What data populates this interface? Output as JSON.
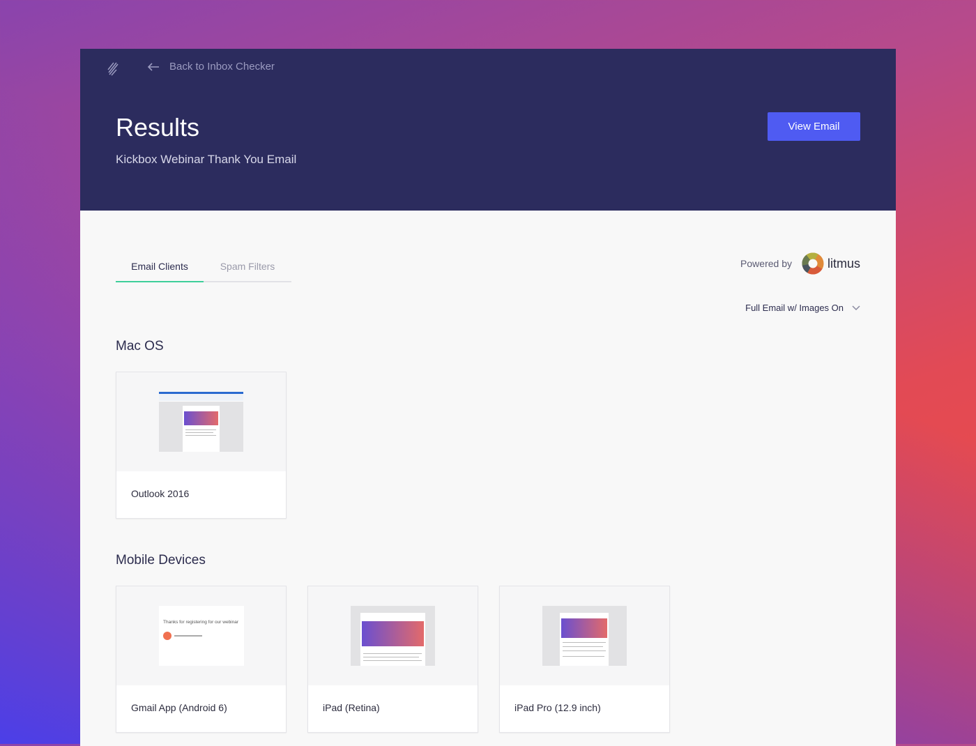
{
  "header": {
    "back_label": "Back to Inbox Checker",
    "title": "Results",
    "subtitle": "Kickbox Webinar Thank You Email",
    "view_email_label": "View Email"
  },
  "tabs": [
    {
      "label": "Email Clients",
      "active": true
    },
    {
      "label": "Spam Filters",
      "active": false
    }
  ],
  "powered": {
    "label": "Powered by",
    "brand": "litmus"
  },
  "view_mode": {
    "selected": "Full Email w/ Images On"
  },
  "sections": [
    {
      "title": "Mac OS",
      "clients": [
        {
          "name": "Outlook 2016"
        }
      ]
    },
    {
      "title": "Mobile Devices",
      "clients": [
        {
          "name": "Gmail App (Android 6)",
          "preview_text": "Thanks for registering for our webinar"
        },
        {
          "name": "iPad (Retina)"
        },
        {
          "name": "iPad Pro (12.9 inch)"
        }
      ]
    }
  ],
  "colors": {
    "header_bg": "#2c2c5e",
    "accent": "#4f5bf2",
    "tab_active": "#3ecf9a"
  }
}
